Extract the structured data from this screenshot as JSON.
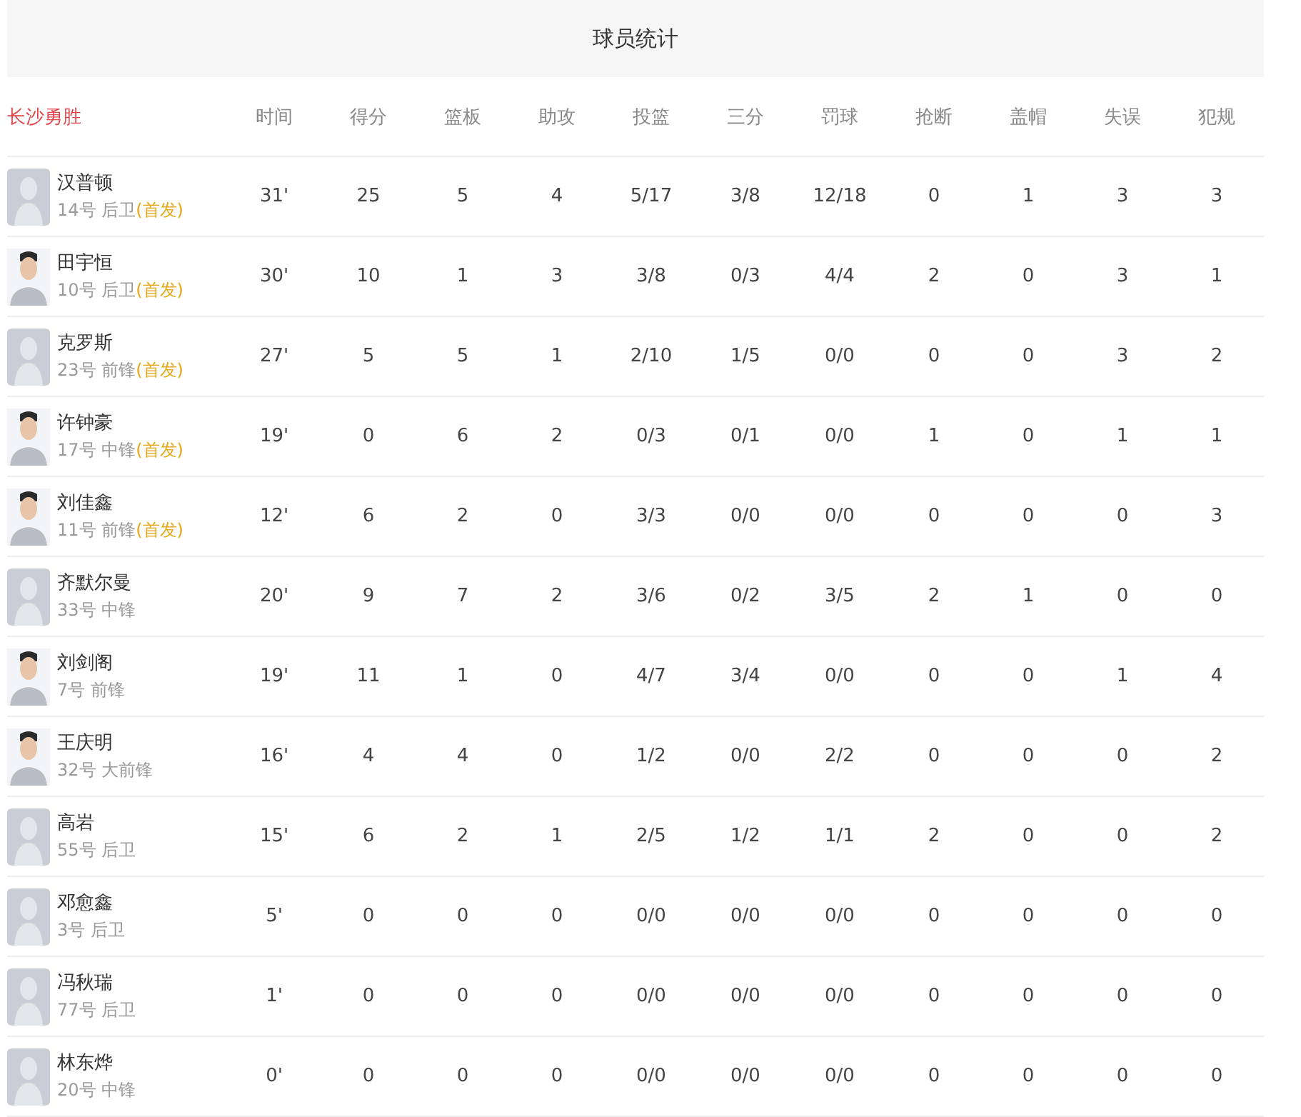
{
  "title": "球员统计",
  "table": {
    "team": "长沙勇胜",
    "columns": [
      "时间",
      "得分",
      "篮板",
      "助攻",
      "投篮",
      "三分",
      "罚球",
      "抢断",
      "盖帽",
      "失误",
      "犯规"
    ],
    "rows": [
      {
        "name": "汉普顿",
        "info": "14号 后卫",
        "badge": "(首发)",
        "kind": "placeholder",
        "stats": [
          "31'",
          "25",
          "5",
          "4",
          "5/17",
          "3/8",
          "12/18",
          "0",
          "1",
          "3",
          "3"
        ]
      },
      {
        "name": "田宇恒",
        "info": "10号 后卫",
        "badge": "(首发)",
        "kind": "photo",
        "stats": [
          "30'",
          "10",
          "1",
          "3",
          "3/8",
          "0/3",
          "4/4",
          "2",
          "0",
          "3",
          "1"
        ]
      },
      {
        "name": "克罗斯",
        "info": "23号 前锋",
        "badge": "(首发)",
        "kind": "placeholder",
        "stats": [
          "27'",
          "5",
          "5",
          "1",
          "2/10",
          "1/5",
          "0/0",
          "0",
          "0",
          "3",
          "2"
        ]
      },
      {
        "name": "许钟豪",
        "info": "17号 中锋",
        "badge": "(首发)",
        "kind": "photo",
        "stats": [
          "19'",
          "0",
          "6",
          "2",
          "0/3",
          "0/1",
          "0/0",
          "1",
          "0",
          "1",
          "1"
        ]
      },
      {
        "name": "刘佳鑫",
        "info": "11号 前锋",
        "badge": "(首发)",
        "kind": "photo",
        "stats": [
          "12'",
          "6",
          "2",
          "0",
          "3/3",
          "0/0",
          "0/0",
          "0",
          "0",
          "0",
          "3"
        ]
      },
      {
        "name": "齐默尔曼",
        "info": "33号 中锋",
        "kind": "placeholder",
        "stats": [
          "20'",
          "9",
          "7",
          "2",
          "3/6",
          "0/2",
          "3/5",
          "2",
          "1",
          "0",
          "0"
        ]
      },
      {
        "name": "刘剑阁",
        "info": "7号 前锋",
        "kind": "photo",
        "stats": [
          "19'",
          "11",
          "1",
          "0",
          "4/7",
          "3/4",
          "0/0",
          "0",
          "0",
          "1",
          "4"
        ]
      },
      {
        "name": "王庆明",
        "info": "32号 大前锋",
        "kind": "photo",
        "stats": [
          "16'",
          "4",
          "4",
          "0",
          "1/2",
          "0/0",
          "2/2",
          "0",
          "0",
          "0",
          "2"
        ]
      },
      {
        "name": "高岩",
        "info": "55号 后卫",
        "kind": "placeholder",
        "stats": [
          "15'",
          "6",
          "2",
          "1",
          "2/5",
          "1/2",
          "1/1",
          "2",
          "0",
          "0",
          "2"
        ]
      },
      {
        "name": "邓愈鑫",
        "info": "3号 后卫",
        "kind": "placeholder",
        "stats": [
          "5'",
          "0",
          "0",
          "0",
          "0/0",
          "0/0",
          "0/0",
          "0",
          "0",
          "0",
          "0"
        ]
      },
      {
        "name": "冯秋瑞",
        "info": "77号 后卫",
        "kind": "placeholder",
        "stats": [
          "1'",
          "0",
          "0",
          "0",
          "0/0",
          "0/0",
          "0/0",
          "0",
          "0",
          "0",
          "0"
        ]
      },
      {
        "name": "林东烨",
        "info": "20号 中锋",
        "kind": "placeholder",
        "stats": [
          "0'",
          "0",
          "0",
          "0",
          "0/0",
          "0/0",
          "0/0",
          "0",
          "0",
          "0",
          "0"
        ]
      }
    ]
  }
}
